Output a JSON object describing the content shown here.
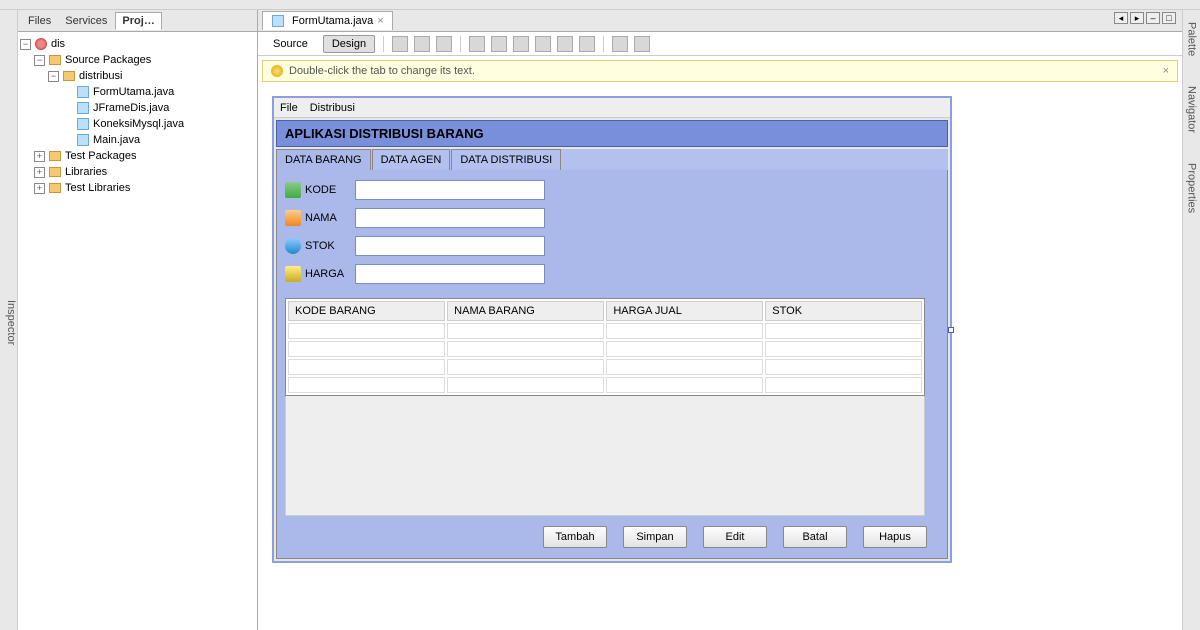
{
  "leftRail": "Inspector",
  "panelTabs": {
    "files": "Files",
    "services": "Services",
    "projects": "Proj…"
  },
  "tree": {
    "root": "dis",
    "srcPkg": "Source Packages",
    "pkg": "distribusi",
    "files": [
      "FormUtama.java",
      "JFrameDis.java",
      "KoneksiMysql.java",
      "Main.java"
    ],
    "testPkg": "Test Packages",
    "libs": "Libraries",
    "testLibs": "Test Libraries"
  },
  "editorTab": "FormUtama.java",
  "modes": {
    "source": "Source",
    "design": "Design"
  },
  "hint": "Double-click the tab to change its text.",
  "formMenu": {
    "file": "File",
    "dist": "Distribusi"
  },
  "formTitle": "APLIKASI DISTRIBUSI BARANG",
  "formTabs": {
    "barang": "DATA BARANG",
    "agen": "DATA AGEN",
    "dist": "DATA DISTRIBUSI"
  },
  "fields": {
    "kode": "KODE",
    "nama": "NAMA",
    "stok": "STOK",
    "harga": "HARGA"
  },
  "columns": {
    "c1": "KODE BARANG",
    "c2": "NAMA BARANG",
    "c3": "HARGA JUAL",
    "c4": "STOK"
  },
  "buttons": {
    "tambah": "Tambah",
    "simpan": "Simpan",
    "edit": "Edit",
    "batal": "Batal",
    "hapus": "Hapus"
  },
  "rightRail": {
    "palette": "Palette",
    "navigator": "Navigator",
    "properties": "Properties"
  }
}
